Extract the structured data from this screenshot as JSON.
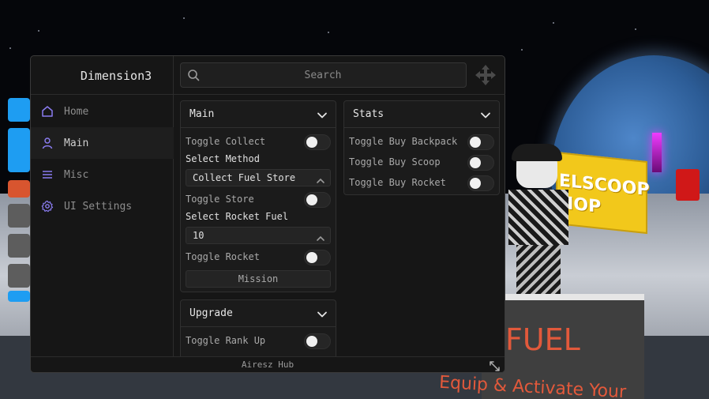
{
  "app": {
    "title": "Dimension3",
    "footer": "Airesz Hub"
  },
  "search": {
    "placeholder": "Search"
  },
  "sidebar": {
    "items": [
      {
        "label": "Home",
        "icon": "home-icon",
        "active": false
      },
      {
        "label": "Main",
        "icon": "user-icon",
        "active": true
      },
      {
        "label": "Misc",
        "icon": "list-icon",
        "active": false
      },
      {
        "label": "UI Settings",
        "icon": "gear-icon",
        "active": false
      }
    ]
  },
  "sections": {
    "main": {
      "title": "Main",
      "toggle_collect": "Toggle Collect",
      "select_method_label": "Select Method",
      "select_method_value": "Collect Fuel Store",
      "toggle_store": "Toggle Store",
      "select_fuel_label": "Select Rocket Fuel",
      "select_fuel_value": "10",
      "toggle_rocket": "Toggle Rocket",
      "mission_button": "Mission"
    },
    "stats": {
      "title": "Stats",
      "toggle_backpack": "Toggle Buy Backpack",
      "toggle_scoop": "Toggle Buy Scoop",
      "toggle_rocket": "Toggle Buy Rocket"
    },
    "upgrade": {
      "title": "Upgrade",
      "toggle_rank": "Toggle Rank Up"
    }
  },
  "scene": {
    "sign_line1": "ELSCOOP",
    "sign_line2": "HOP",
    "fuel_text": "FUEL",
    "fuel_subtext": "Equip & Activate Your"
  },
  "colors": {
    "accent": "#8a7cf0",
    "panel": "#161616",
    "section": "#1b1b1b"
  }
}
